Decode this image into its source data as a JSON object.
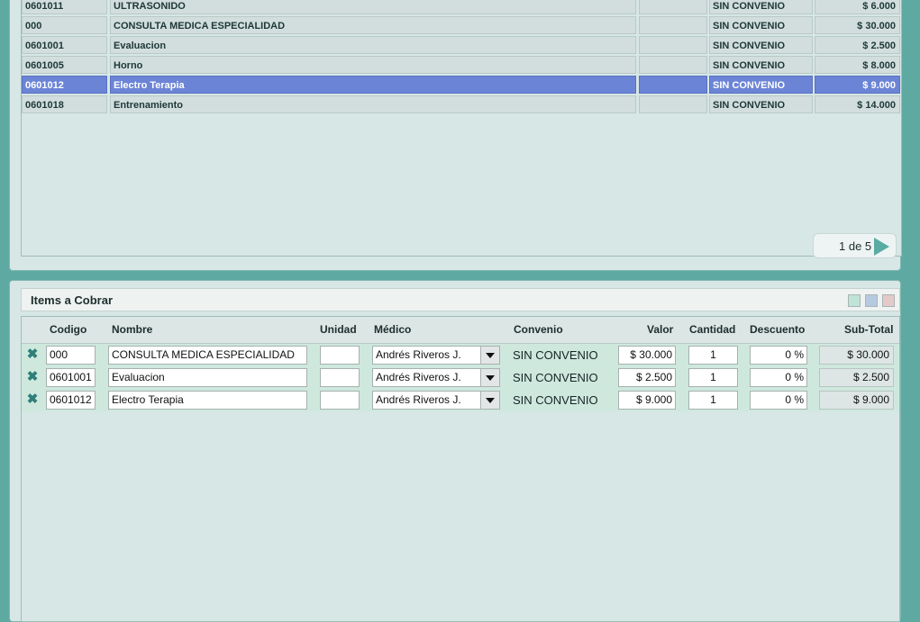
{
  "services": {
    "rows": [
      {
        "code": "0601011",
        "name": "ULTRASONIDO",
        "unit": "",
        "convenio": "SIN CONVENIO",
        "price": "$ 6.000"
      },
      {
        "code": "000",
        "name": "CONSULTA MEDICA ESPECIALIDAD",
        "unit": "",
        "convenio": "SIN CONVENIO",
        "price": "$ 30.000"
      },
      {
        "code": "0601001",
        "name": "Evaluacion",
        "unit": "",
        "convenio": "SIN CONVENIO",
        "price": "$ 2.500"
      },
      {
        "code": "0601005",
        "name": "Horno",
        "unit": "",
        "convenio": "SIN CONVENIO",
        "price": "$ 8.000"
      },
      {
        "code": "0601012",
        "name": "Electro Terapia",
        "unit": "",
        "convenio": "SIN CONVENIO",
        "price": "$ 9.000"
      },
      {
        "code": "0601018",
        "name": "Entrenamiento",
        "unit": "",
        "convenio": "SIN CONVENIO",
        "price": "$ 14.000"
      }
    ],
    "selected_index": 4,
    "pager": {
      "label": "1 de 5"
    }
  },
  "items": {
    "title": "Items a Cobrar",
    "columns": {
      "codigo": "Codigo",
      "nombre": "Nombre",
      "unidad": "Unidad",
      "medico": "Médico",
      "convenio": "Convenio",
      "valor": "Valor",
      "cantidad": "Cantidad",
      "descuento": "Descuento",
      "subtotal": "Sub-Total"
    },
    "rows": [
      {
        "code": "000",
        "name": "CONSULTA MEDICA ESPECIALIDAD",
        "unit": "",
        "medico": "Andrés Riveros J.",
        "convenio": "SIN CONVENIO",
        "valor": "$ 30.000",
        "cantidad": "1",
        "descuento": "0 %",
        "subtotal": "$ 30.000"
      },
      {
        "code": "0601001",
        "name": "Evaluacion",
        "unit": "",
        "medico": "Andrés Riveros J.",
        "convenio": "SIN CONVENIO",
        "valor": "$ 2.500",
        "cantidad": "1",
        "descuento": "0 %",
        "subtotal": "$ 2.500"
      },
      {
        "code": "0601012",
        "name": "Electro Terapia",
        "unit": "",
        "medico": "Andrés Riveros J.",
        "convenio": "SIN CONVENIO",
        "valor": "$ 9.000",
        "cantidad": "1",
        "descuento": "0 %",
        "subtotal": "$ 9.000"
      }
    ]
  },
  "colors": {
    "background": "#5fa9a3",
    "panel": "#d7e7e5",
    "selection": "#6b84d6",
    "item_row": "#cfe8de",
    "delete_icon": "#2e7f78"
  },
  "icons": {
    "delete": "close-x-icon",
    "pager_next": "play-arrow-icon",
    "dropdown": "chevron-down-icon"
  }
}
